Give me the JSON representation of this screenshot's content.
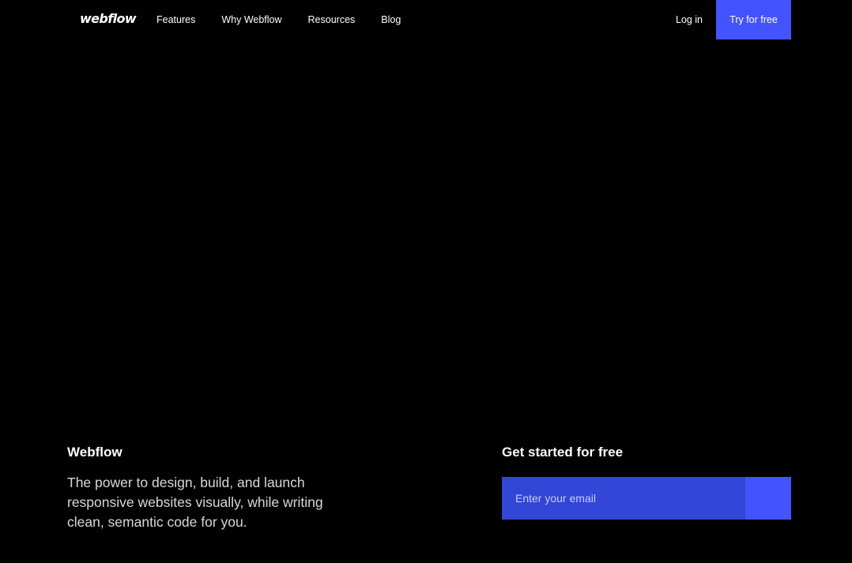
{
  "nav": {
    "logo": "webflow",
    "links": [
      "Features",
      "Why Webflow",
      "Resources",
      "Blog"
    ],
    "login": "Log in",
    "cta": "Try for free"
  },
  "brand": {
    "title": "Webflow",
    "description": "The power to design, build, and launch responsive websites visually, while writing clean, semantic code for you."
  },
  "signup": {
    "title": "Get started for free",
    "email_placeholder": "Enter your email"
  },
  "colors": {
    "background": "#000000",
    "accent": "#4353ff",
    "input_background": "#3246d8"
  }
}
